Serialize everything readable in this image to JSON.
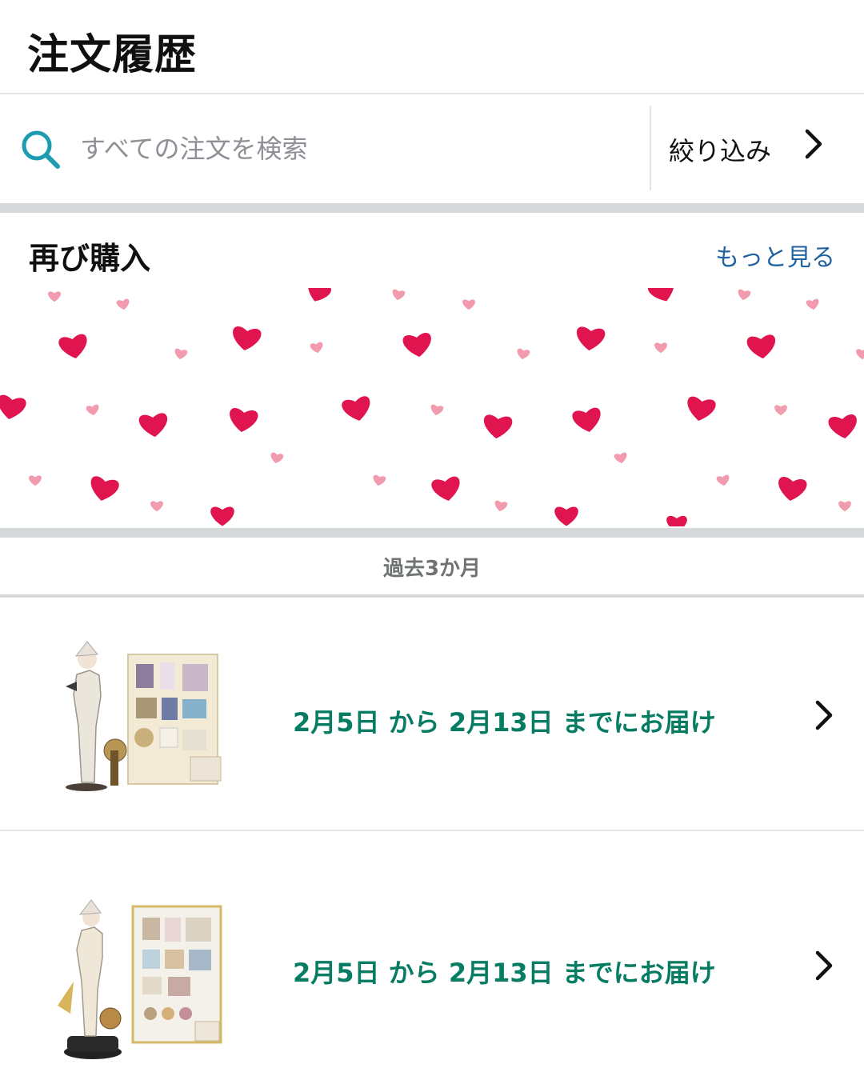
{
  "header": {
    "title": "注文履歴"
  },
  "search": {
    "placeholder": "すべての注文を検索",
    "filter_label": "絞り込み"
  },
  "buy_again": {
    "title": "再び購入",
    "see_more": "もっと見る"
  },
  "period": {
    "label": "過去3か月"
  },
  "orders": [
    {
      "delivery": "2月5日 から 2月13日 までにお届け"
    },
    {
      "delivery": "2月5日 から 2月13日 までにお届け"
    }
  ],
  "colors": {
    "accent_teal": "#067d62",
    "link_blue": "#2162a1",
    "search_icon": "#1e9bb0",
    "heart_red": "#e0144f",
    "heart_pink": "#f29aae",
    "band_gray": "#d5d9d9"
  },
  "icons": {
    "search": "search-icon",
    "filter_chevron": "chevron-right-icon",
    "order_chevron": "chevron-right-icon"
  }
}
